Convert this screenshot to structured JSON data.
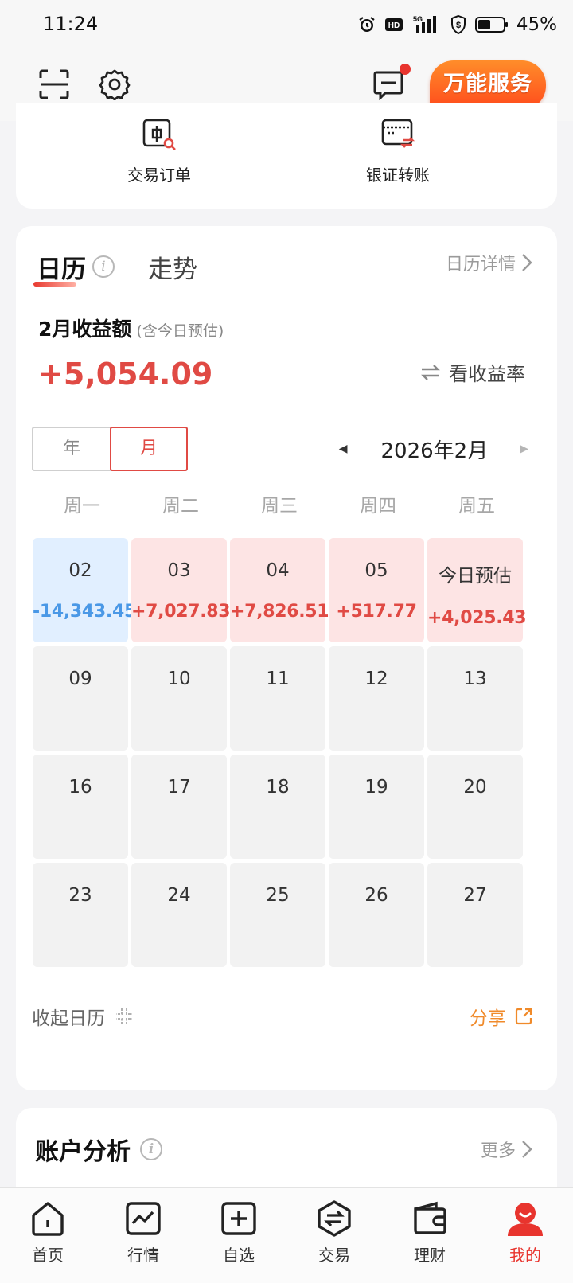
{
  "status_bar": {
    "time": "11:24",
    "icons": [
      "alarm-icon",
      "hd-icon",
      "5g-signal-icon",
      "shield-icon",
      "battery-icon"
    ],
    "battery": "45%"
  },
  "header": {
    "service_button": "万能服务",
    "message_badge": true
  },
  "quick_actions": [
    {
      "label": "交易订单",
      "icon": "order-search-icon"
    },
    {
      "label": "银证转账",
      "icon": "bank-transfer-icon"
    }
  ],
  "calendar_card": {
    "tabs": {
      "calendar": "日历",
      "trend": "走势"
    },
    "detail_link": "日历详情",
    "month_title": "2月收益额",
    "month_note": "(含今日预估)",
    "month_total": "+5,054.09",
    "rate_toggle": "看收益率",
    "segments": {
      "year": "年",
      "month": "月",
      "active": "month"
    },
    "current_month": "2026年2月",
    "weekdays": [
      "周一",
      "周二",
      "周三",
      "周四",
      "周五"
    ],
    "days": [
      {
        "d": "02",
        "v": "-14,343.45",
        "state": "loss"
      },
      {
        "d": "03",
        "v": "+7,027.83",
        "state": "gain"
      },
      {
        "d": "04",
        "v": "+7,826.51",
        "state": "gain"
      },
      {
        "d": "05",
        "v": "+517.77",
        "state": "gain"
      },
      {
        "d": "今日预估",
        "v": "+4,025.43",
        "state": "gain"
      },
      {
        "d": "09",
        "v": "",
        "state": "none"
      },
      {
        "d": "10",
        "v": "",
        "state": "none"
      },
      {
        "d": "11",
        "v": "",
        "state": "none"
      },
      {
        "d": "12",
        "v": "",
        "state": "none"
      },
      {
        "d": "13",
        "v": "",
        "state": "none"
      },
      {
        "d": "16",
        "v": "",
        "state": "none"
      },
      {
        "d": "17",
        "v": "",
        "state": "none"
      },
      {
        "d": "18",
        "v": "",
        "state": "none"
      },
      {
        "d": "19",
        "v": "",
        "state": "none"
      },
      {
        "d": "20",
        "v": "",
        "state": "none"
      },
      {
        "d": "23",
        "v": "",
        "state": "none"
      },
      {
        "d": "24",
        "v": "",
        "state": "none"
      },
      {
        "d": "25",
        "v": "",
        "state": "none"
      },
      {
        "d": "26",
        "v": "",
        "state": "none"
      },
      {
        "d": "27",
        "v": "",
        "state": "none"
      }
    ],
    "collapse": "收起日历",
    "share": "分享"
  },
  "account_card": {
    "title": "账户分析",
    "more": "更多"
  },
  "bottom_nav": [
    {
      "label": "首页",
      "icon": "home-icon"
    },
    {
      "label": "行情",
      "icon": "market-chart-icon"
    },
    {
      "label": "自选",
      "icon": "watchlist-add-icon"
    },
    {
      "label": "交易",
      "icon": "trade-exchange-icon"
    },
    {
      "label": "理财",
      "icon": "wallet-icon"
    },
    {
      "label": "我的",
      "icon": "profile-icon",
      "active": true
    }
  ],
  "colors": {
    "gain": "#e04a44",
    "loss": "#4a98e6",
    "accent_orange": "#f08a2a",
    "brand_red": "#e8342e"
  }
}
